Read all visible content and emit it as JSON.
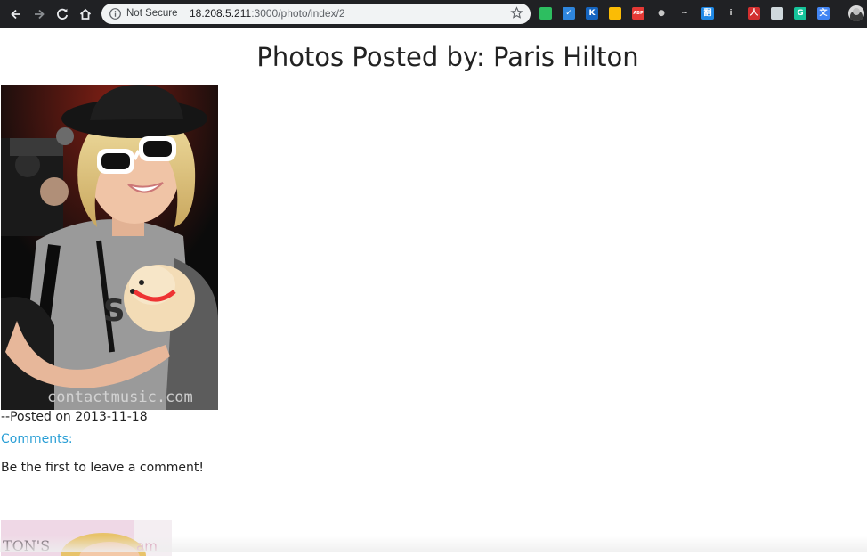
{
  "browser": {
    "security_label": "Not Secure",
    "url_host": "18.208.5.211",
    "url_rest": ":3000/photo/index/2",
    "extensions": [
      {
        "name": "evernote-icon",
        "glyph": "",
        "color": "#2dbe60"
      },
      {
        "name": "todo-check-icon",
        "glyph": "✓",
        "color": "#2e86de"
      },
      {
        "name": "k-extension-icon",
        "glyph": "K",
        "color": "#1565c0"
      },
      {
        "name": "google-drive-icon",
        "glyph": "",
        "color": "#fbbc05"
      },
      {
        "name": "adblock-plus-icon",
        "glyph": "ABP",
        "color": "#e53935"
      },
      {
        "name": "dot-extension-icon",
        "glyph": "●",
        "color": "transparent"
      },
      {
        "name": "sketch-extension-icon",
        "glyph": "~",
        "color": "transparent"
      },
      {
        "name": "translate-cn-icon",
        "glyph": "翻",
        "color": "#1e88e5"
      },
      {
        "name": "info-extension-icon",
        "glyph": "i",
        "color": "transparent"
      },
      {
        "name": "acrobat-icon",
        "glyph": "人",
        "color": "#d32f2f"
      },
      {
        "name": "chat-bubble-icon",
        "glyph": "",
        "color": "#cfd8dc"
      },
      {
        "name": "grammarly-icon",
        "glyph": "G",
        "color": "#15c39a"
      },
      {
        "name": "google-translate-icon",
        "glyph": "文",
        "color": "#4285f4"
      }
    ]
  },
  "page": {
    "title": "Photos Posted by: Paris Hilton",
    "posts": [
      {
        "posted_text": "--Posted on 2013-11-18",
        "comments_label": "Comments:",
        "empty_comments_text": "Be the first to leave a comment!",
        "watermark": "contactmusic.com"
      },
      {
        "photo_text": "TON'S"
      }
    ]
  },
  "colors": {
    "link": "#2a9fd6",
    "chrome_toolbar": "#202124"
  }
}
